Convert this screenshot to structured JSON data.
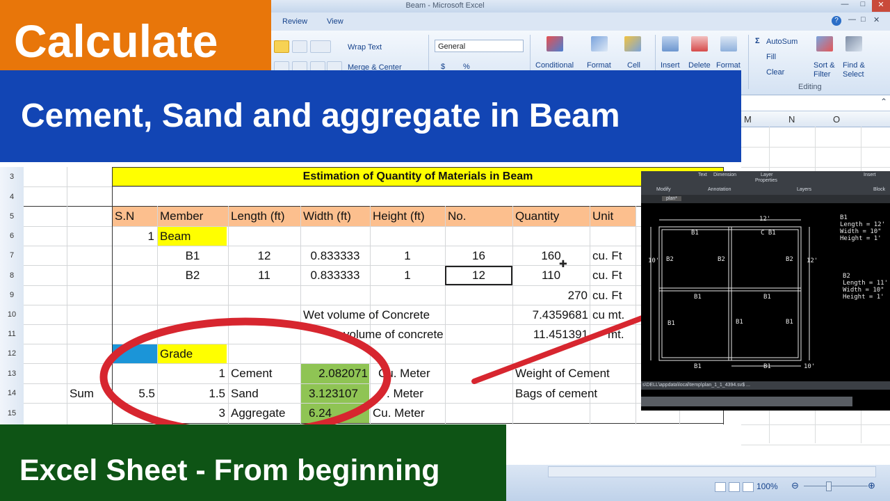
{
  "window": {
    "title": "Beam - Microsoft Excel"
  },
  "menu": {
    "tabs": [
      "Review",
      "View"
    ]
  },
  "ribbon": {
    "wrap_text": "Wrap Text",
    "merge_center": "Merge & Center",
    "number_format": "General",
    "currency": "$",
    "percent": "%",
    "conditional": "Conditional",
    "format_as": "Format",
    "cell_styles": "Cell",
    "insert": "Insert",
    "delete": "Delete",
    "format": "Format",
    "autosum": "AutoSum",
    "fill": "Fill",
    "clear": "Clear",
    "sort_filter_1": "Sort &",
    "sort_filter_2": "Filter",
    "find_select_1": "Find &",
    "find_select_2": "Select",
    "editing_group": "Editing"
  },
  "columns_visible": [
    "M",
    "N",
    "O"
  ],
  "rows": [
    "3",
    "4",
    "5",
    "6",
    "7",
    "8",
    "9",
    "10",
    "11",
    "12",
    "13",
    "14",
    "15"
  ],
  "sheet": {
    "title": "Estimation of Quantity of Materials in Beam",
    "headers": [
      "S.N",
      "Member",
      "Length (ft)",
      "Width (ft)",
      "Height (ft)",
      "No.",
      "Quantity",
      "Unit"
    ],
    "r6": {
      "sn": "1",
      "member": "Beam"
    },
    "r7": {
      "member": "B1",
      "length": "12",
      "width": "0.833333",
      "height": "1",
      "no": "16",
      "qty": "160",
      "unit": "cu. Ft"
    },
    "r8": {
      "member": "B2",
      "length": "11",
      "width": "0.833333",
      "height": "1",
      "no": "12",
      "qty": "110",
      "unit": "cu. Ft"
    },
    "r9": {
      "qty": "270",
      "unit": "cu. Ft"
    },
    "r10": {
      "label": "Wet volume of Concrete",
      "qty": "7.4359681",
      "unit": "cu mt."
    },
    "r11": {
      "label": "volume of concrete",
      "qty": "11.451391",
      "unit": "mt."
    },
    "r12": {
      "grade": "Grade"
    },
    "r13": {
      "ratio": "1",
      "material": "Cement",
      "value": "2.082071",
      "unit": "Cu. Meter",
      "note": "Weight of Cement"
    },
    "r14": {
      "sum_label": "Sum",
      "sum": "5.5",
      "ratio": "1.5",
      "material": "Sand",
      "value": "3.123107",
      "unit": ". Meter",
      "note": "Bags of cement"
    },
    "r15": {
      "ratio": "3",
      "material": "Aggregate",
      "value": "6.24",
      "unit": "Cu. Meter"
    }
  },
  "overlay": {
    "top_left": "Calculate",
    "banner": "Cement, Sand and aggregate in Beam",
    "bottom": "Excel Sheet - From beginning"
  },
  "status": {
    "zoom": "100%"
  },
  "cad": {
    "ribbon_labels": [
      "Modify",
      "Annotation",
      "Layers",
      "Block"
    ],
    "ribbon_text": [
      "Text",
      "Dimension",
      "Layer",
      "Properties",
      "Insert"
    ],
    "tab_label": "plan*",
    "dim_top": "12'",
    "dim_left": "10'",
    "dim_right": "12'",
    "dim_bottom": "10'",
    "beam_labels": [
      "B1",
      "B2"
    ],
    "center_label": "C B1",
    "info_b1": [
      "B1",
      "Length = 12'",
      "Width = 10\"",
      "Height = 1'"
    ],
    "info_b2": [
      "B2",
      "Length = 11'",
      "Width = 10\"",
      "Height = 1'"
    ],
    "cmdline": "s\\DELL\\appdata\\local\\temp\\plan_1_1_4394.sv$ ..."
  },
  "colors": {
    "orange": "#e8760a",
    "blue": "#1245b4",
    "green": "#0e5415",
    "header_fill": "#fcbf8e",
    "yellow": "#ffff00",
    "green_cell": "#8fc454",
    "red_ellipse": "#d7262f"
  }
}
